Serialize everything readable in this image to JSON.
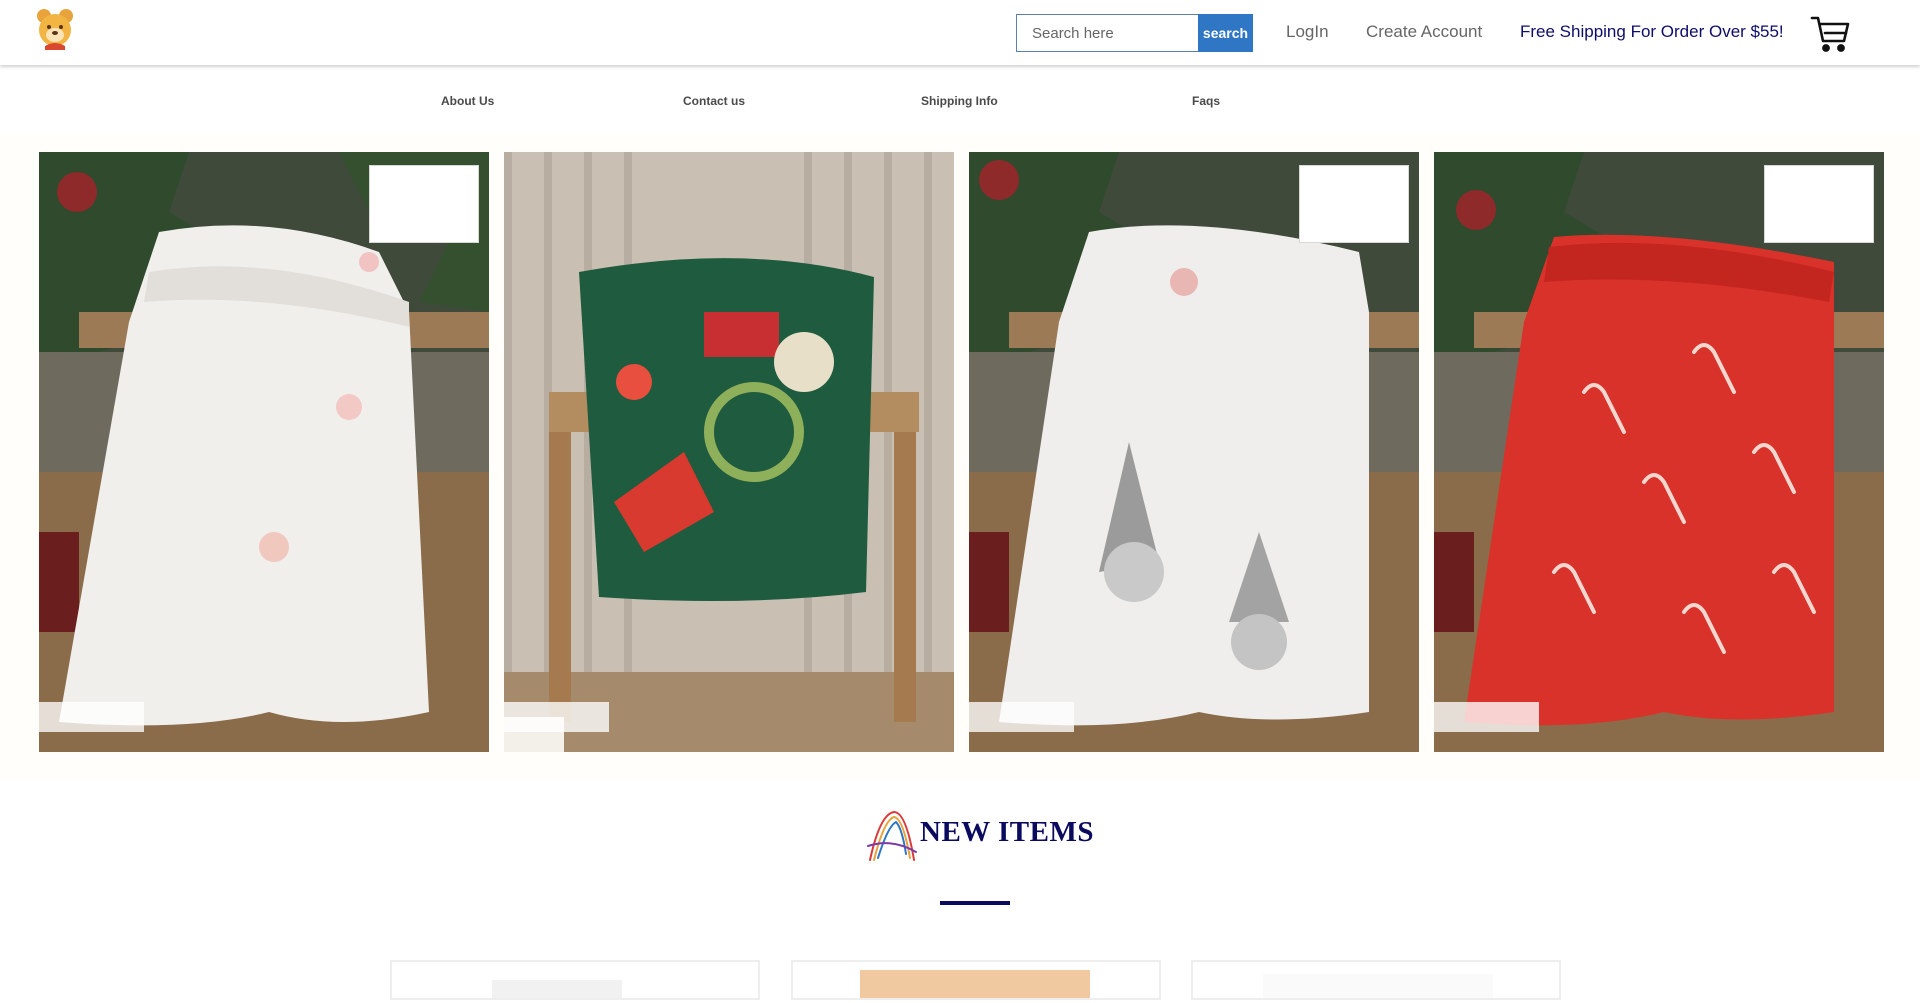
{
  "header": {
    "logo_icon": "bear-logo-icon",
    "search": {
      "placeholder": "Search here",
      "value": "",
      "button_label": "search"
    },
    "login_label": "LogIn",
    "create_account_label": "Create Account",
    "promo_text": "Free Shipping For Order Over $55!",
    "cart_icon": "cart-icon"
  },
  "nav": {
    "items": [
      {
        "label": "About Us"
      },
      {
        "label": "Contact us"
      },
      {
        "label": "Shipping Info"
      },
      {
        "label": "Faqs"
      }
    ]
  },
  "hero": {
    "cards": [
      {
        "image": "white-blanket-reindeer-photo"
      },
      {
        "image": "green-christmas-blanket-photo"
      },
      {
        "image": "white-blanket-gnome-photo"
      },
      {
        "image": "red-candy-cane-blanket-photo"
      }
    ]
  },
  "new_items": {
    "title": "NEW ITEMS",
    "icon": "rainbow-a-logo-icon"
  },
  "colors": {
    "accent": "#2f77c4",
    "navy": "#0a0a5e",
    "promo": "#0d0d6b"
  }
}
